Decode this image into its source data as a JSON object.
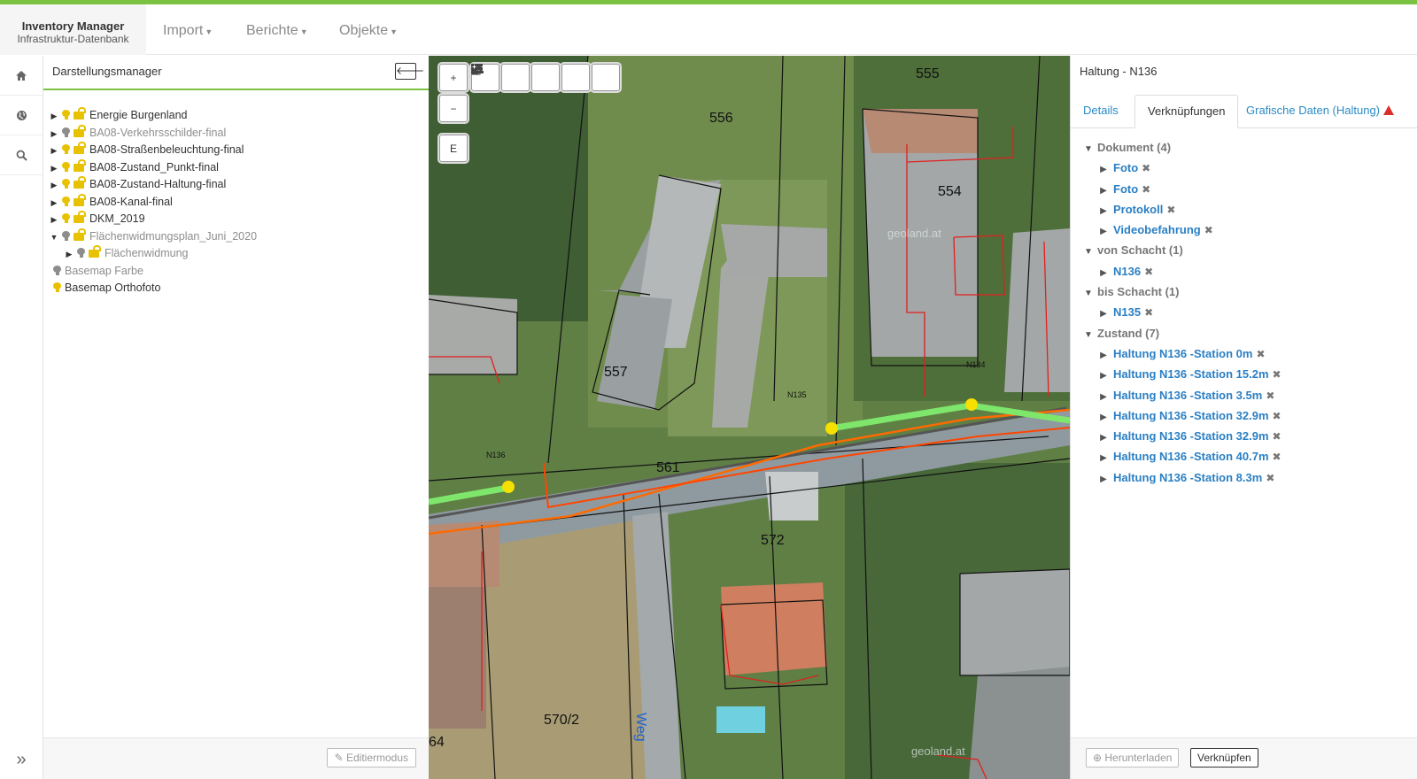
{
  "brand": {
    "title": "Inventory Manager",
    "subtitle": "Infrastruktur-Datenbank"
  },
  "nav": {
    "items": [
      {
        "label": "Import"
      },
      {
        "label": "Berichte"
      },
      {
        "label": "Objekte"
      }
    ]
  },
  "rail": {
    "icons": [
      "home-icon",
      "globe-icon",
      "search-icon"
    ],
    "expand_icon": "double-chevron-right-icon"
  },
  "left_panel": {
    "title": "Darstellungsmanager",
    "collapse_icon": "arrow-left-icon",
    "layers": [
      {
        "label": "Energie Burgenland",
        "visible": true,
        "locked": true,
        "dim": false,
        "expanded": false,
        "level": 0,
        "toggle": true
      },
      {
        "label": "BA08-Verkehrsschilder-final",
        "visible": false,
        "locked": true,
        "dim": true,
        "expanded": false,
        "level": 0,
        "toggle": true
      },
      {
        "label": "BA08-Straßenbeleuchtung-final",
        "visible": true,
        "locked": true,
        "dim": false,
        "expanded": false,
        "level": 0,
        "toggle": true
      },
      {
        "label": "BA08-Zustand_Punkt-final",
        "visible": true,
        "locked": true,
        "dim": false,
        "expanded": false,
        "level": 0,
        "toggle": true
      },
      {
        "label": "BA08-Zustand-Haltung-final",
        "visible": true,
        "locked": true,
        "dim": false,
        "expanded": false,
        "level": 0,
        "toggle": true
      },
      {
        "label": "BA08-Kanal-final",
        "visible": true,
        "locked": true,
        "dim": false,
        "expanded": false,
        "level": 0,
        "toggle": true
      },
      {
        "label": "DKM_2019",
        "visible": true,
        "locked": true,
        "dim": false,
        "expanded": false,
        "level": 0,
        "toggle": true
      },
      {
        "label": "Flächenwidmungsplan_Juni_2020",
        "visible": false,
        "locked": true,
        "dim": true,
        "expanded": true,
        "level": 0,
        "toggle": true
      },
      {
        "label": "Flächenwidmung",
        "visible": false,
        "locked": true,
        "dim": true,
        "expanded": false,
        "level": 1,
        "toggle": true
      },
      {
        "label": "Basemap Farbe",
        "visible": false,
        "locked": false,
        "dim": true,
        "expanded": false,
        "level": 0,
        "toggle": false
      },
      {
        "label": "Basemap Orthofoto",
        "visible": true,
        "locked": false,
        "dim": false,
        "expanded": false,
        "level": 0,
        "toggle": false
      }
    ],
    "edit_button": "Editiermodus"
  },
  "map": {
    "tools": [
      "zoom-in",
      "zoom-out",
      "hierarchy",
      "list",
      "fullscreen",
      "pdf-export",
      "move"
    ],
    "zoom_in": "+",
    "zoom_out": "−",
    "edit_label": "E",
    "parcel_labels": [
      "555",
      "556",
      "554",
      "557",
      "561",
      "572",
      "570/2",
      "64"
    ],
    "manhole_labels": [
      "N136",
      "N135",
      "N134"
    ],
    "street_label": "Weg",
    "watermark": "geoland.at",
    "colors": {
      "pipe_green": "#7ee66b",
      "pipe_orange": "#ff6a00",
      "manhole_yellow": "#f5e000",
      "parcel_line": "#111111",
      "zoning_red": "#e02020"
    }
  },
  "right_panel": {
    "title": "Haltung - N136",
    "tabs": [
      {
        "label": "Details",
        "active": false
      },
      {
        "label": "Verknüpfungen",
        "active": true
      },
      {
        "label": "Grafische Daten (Haltung)",
        "active": false,
        "warning": true
      }
    ],
    "groups": [
      {
        "label": "Dokument (4)",
        "items": [
          "Foto",
          "Foto",
          "Protokoll",
          "Videobefahrung"
        ]
      },
      {
        "label": "von Schacht (1)",
        "items": [
          "N136"
        ]
      },
      {
        "label": "bis Schacht (1)",
        "items": [
          "N135"
        ]
      },
      {
        "label": "Zustand (7)",
        "items": [
          "Haltung N136 -Station 0m",
          "Haltung N136 -Station 15.2m",
          "Haltung N136 -Station 3.5m",
          "Haltung N136 -Station 32.9m",
          "Haltung N136 -Station 32.9m",
          "Haltung N136 -Station 40.7m",
          "Haltung N136 -Station 8.3m"
        ]
      }
    ],
    "download_button": "Herunterladen",
    "link_button": "Verknüpfen"
  }
}
